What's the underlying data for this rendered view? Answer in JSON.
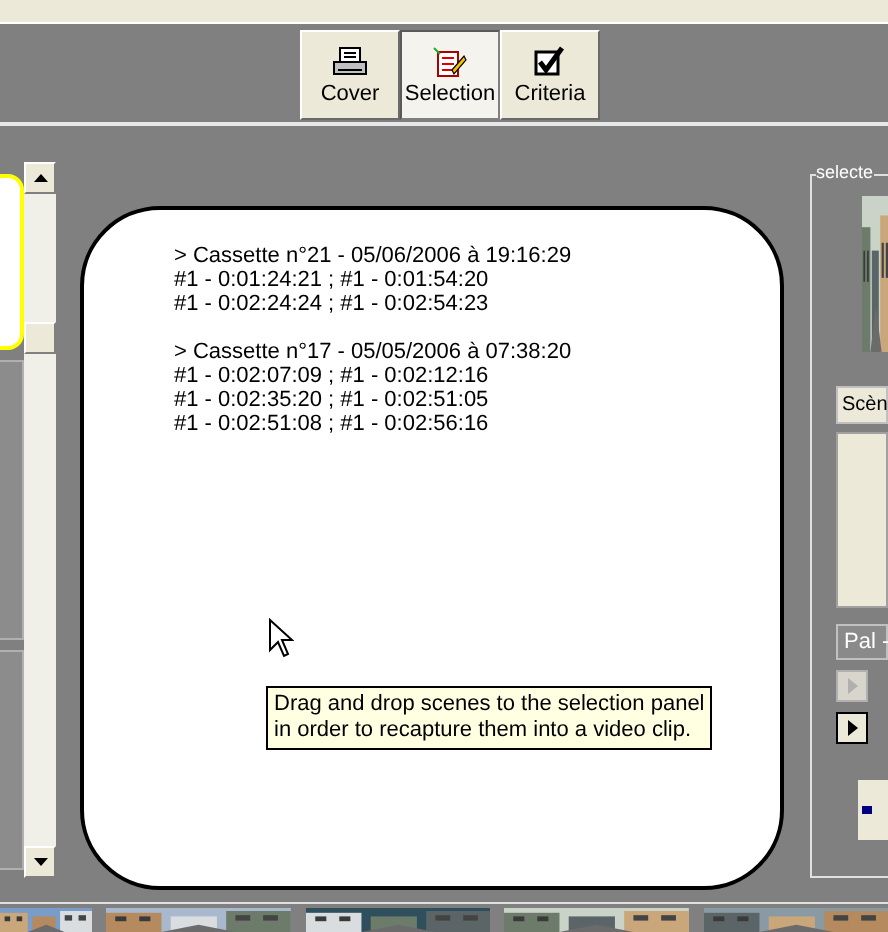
{
  "toolbar": [
    {
      "label": "Cover",
      "kind": "printer",
      "selected": false
    },
    {
      "label": "Selection",
      "kind": "notepad",
      "selected": true
    },
    {
      "label": "Criteria",
      "kind": "checkbox",
      "selected": false
    }
  ],
  "selection_list": [
    {
      "header": "> Cassette n°21 - 05/06/2006 à 19:16:29",
      "scenes": [
        "#1 - 0:01:24:21 ; #1 - 0:01:54:20",
        "#1 - 0:02:24:24 ; #1 - 0:02:54:23"
      ]
    },
    {
      "header": "> Cassette n°17 - 05/05/2006 à 07:38:20",
      "scenes": [
        "#1 - 0:02:07:09 ; #1 - 0:02:12:16",
        "#1 - 0:02:35:20 ; #1 - 0:02:51:05",
        "#1 - 0:02:51:08 ; #1 - 0:02:56:16"
      ]
    }
  ],
  "tooltip": {
    "lines": [
      "Drag and drop scenes to the selection panel",
      "in order to recapture them into a video clip."
    ]
  },
  "right_panel": {
    "group_label": "selecte",
    "scene_dropdown": "Scèn",
    "format_field": "Pal -",
    "play_buttons": [
      {
        "disabled": true
      },
      {
        "disabled": false
      }
    ]
  }
}
